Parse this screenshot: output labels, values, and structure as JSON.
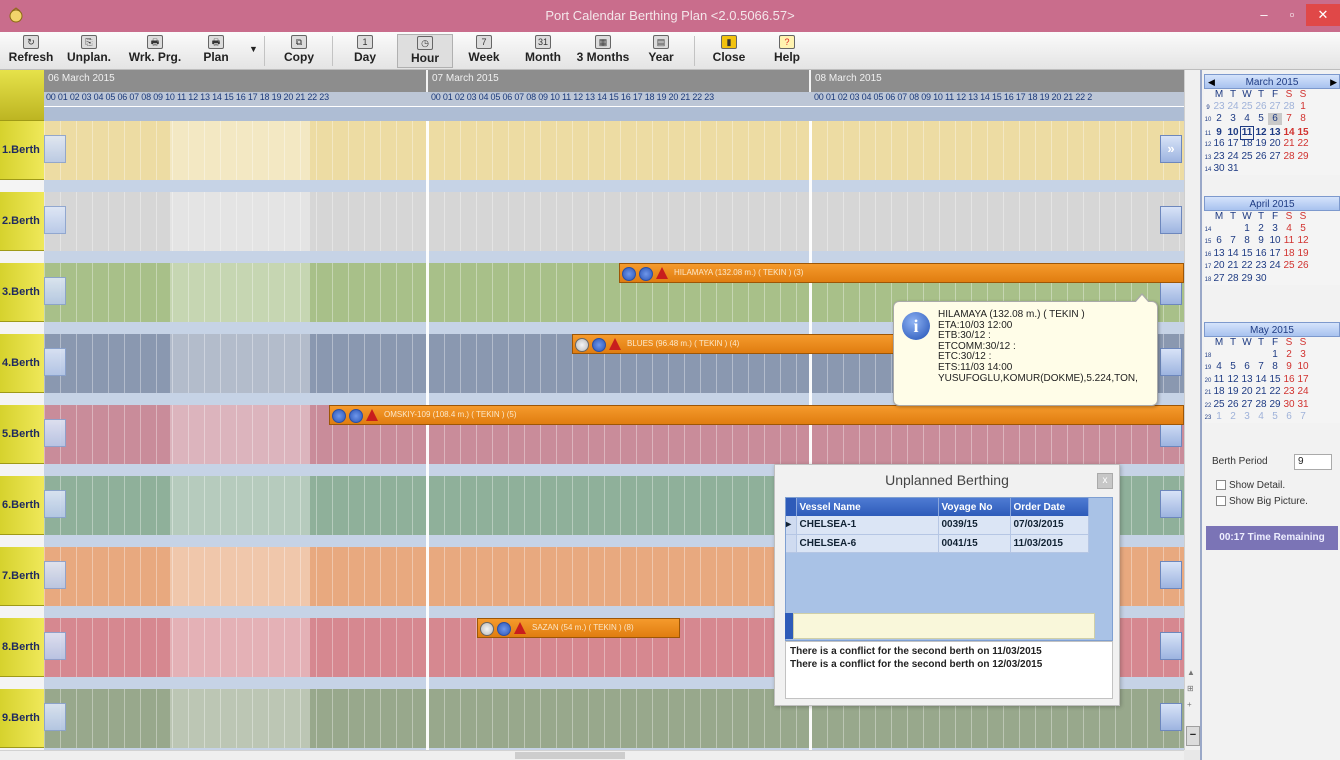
{
  "window": {
    "title": "Port Calendar Berthing Plan <2.0.5066.57>",
    "min": "–",
    "max": "▫",
    "close": "✕"
  },
  "toolbar": {
    "buttons": [
      {
        "label": "Refresh",
        "icon": "refresh-icon"
      },
      {
        "label": "Unplan.",
        "icon": "unplan-icon"
      },
      {
        "label": "Wrk. Prg.",
        "icon": "printer-icon"
      },
      {
        "label": "Plan",
        "icon": "printer-icon"
      },
      {
        "label": "Copy",
        "icon": "copy-icon"
      },
      {
        "label": "Day",
        "icon": "day-calendar-icon"
      },
      {
        "label": "Hour",
        "icon": "hour-icon"
      },
      {
        "label": "Week",
        "icon": "week-calendar-icon"
      },
      {
        "label": "Month",
        "icon": "month-calendar-icon"
      },
      {
        "label": "3 Months",
        "icon": "three-months-icon"
      },
      {
        "label": "Year",
        "icon": "year-icon"
      },
      {
        "label": "Close",
        "icon": "door-icon"
      },
      {
        "label": "Help",
        "icon": "help-icon"
      }
    ],
    "icon_glyphs": [
      "↻",
      "⎘",
      "🖶",
      "🖶",
      "⧉",
      "1",
      "◷",
      "7",
      "31",
      "▦",
      "▤",
      "▮",
      "?"
    ]
  },
  "timeline": {
    "days": [
      "06 March 2015",
      "07 March 2015",
      "08 March 2015"
    ],
    "hours": "00 01 02 03 04 05 06 07 08 09 10 11 12 13 14 15 16 17 18 19 20 21 22 23",
    "hours_partial": "00 01 02 03 04 05 06 07 08 09 10 11 12 13 14 15 16 17 18 19 20 21 22 2"
  },
  "berths": [
    "1.Berth",
    "2.Berth",
    "3.Berth",
    "4.Berth",
    "5.Berth",
    "6.Berth",
    "7.Berth",
    "8.Berth",
    "9.Berth"
  ],
  "berth_colors": [
    "#eddca3",
    "#d6d6d6",
    "#a8c089",
    "#8a98b0",
    "#c98c9a",
    "#8fb09a",
    "#e8a97f",
    "#d68890",
    "#98a88c"
  ],
  "nav_next": "»",
  "vessels": [
    {
      "text": "HILAMAYA (132.08 m.) ( TEKIN ) (3)"
    },
    {
      "text": "BLUES (96.48 m.) ( TEKIN ) (4)"
    },
    {
      "text": "OMSKIY-109 (108.4 m.) ( TEKIN ) (5)"
    },
    {
      "text": "SAZAN (54 m.) ( TEKIN ) (8)"
    }
  ],
  "tooltip": {
    "lines": [
      "HILAMAYA (132.08 m.) ( TEKIN )",
      "ETA:10/03 12:00",
      "ETB:30/12   :",
      "ETCOMM:30/12   :",
      "ETC:30/12   :",
      "ETS:11/03 14:00",
      "YUSUFOGLU,KOMUR(DOKME),5.224,TON,"
    ],
    "icon": "i"
  },
  "unplanned": {
    "title": "Unplanned Berthing",
    "close": "x",
    "columns": [
      "Vessel Name",
      "Voyage No",
      "Order Date"
    ],
    "rows": [
      [
        "CHELSEA-1",
        "0039/15",
        "07/03/2015"
      ],
      [
        "CHELSEA-6",
        "0041/15",
        "11/03/2015"
      ]
    ],
    "messages": [
      "There is a conflict for the second berth on 11/03/2015",
      "There is a conflict for the second berth on 12/03/2015"
    ]
  },
  "calendar": {
    "dows": [
      "M",
      "T",
      "W",
      "T",
      "F",
      "S",
      "S"
    ],
    "months": [
      {
        "title": "March 2015",
        "weeks": [
          [
            "9",
            "23",
            "24",
            "25",
            "26",
            "27",
            "28",
            "1"
          ],
          [
            "10",
            "2",
            "3",
            "4",
            "5",
            "6",
            "7",
            "8"
          ],
          [
            "11",
            "9",
            "10",
            "11",
            "12",
            "13",
            "14",
            "15"
          ],
          [
            "12",
            "16",
            "17",
            "18",
            "19",
            "20",
            "21",
            "22"
          ],
          [
            "13",
            "23",
            "24",
            "25",
            "26",
            "27",
            "28",
            "29"
          ],
          [
            "14",
            "30",
            "31",
            "",
            "",
            "",
            "",
            ""
          ]
        ]
      },
      {
        "title": "April 2015",
        "weeks": [
          [
            "14",
            "",
            "",
            "1",
            "2",
            "3",
            "4",
            "5"
          ],
          [
            "15",
            "6",
            "7",
            "8",
            "9",
            "10",
            "11",
            "12"
          ],
          [
            "16",
            "13",
            "14",
            "15",
            "16",
            "17",
            "18",
            "19"
          ],
          [
            "17",
            "20",
            "21",
            "22",
            "23",
            "24",
            "25",
            "26"
          ],
          [
            "18",
            "27",
            "28",
            "29",
            "30",
            "",
            "",
            ""
          ]
        ]
      },
      {
        "title": "May 2015",
        "weeks": [
          [
            "18",
            "",
            "",
            "",
            "",
            "1",
            "2",
            "3"
          ],
          [
            "19",
            "4",
            "5",
            "6",
            "7",
            "8",
            "9",
            "10"
          ],
          [
            "20",
            "11",
            "12",
            "13",
            "14",
            "15",
            "16",
            "17"
          ],
          [
            "21",
            "18",
            "19",
            "20",
            "21",
            "22",
            "23",
            "24"
          ],
          [
            "22",
            "25",
            "26",
            "27",
            "28",
            "29",
            "30",
            "31"
          ],
          [
            "23",
            "1",
            "2",
            "3",
            "4",
            "5",
            "6",
            "7"
          ]
        ]
      }
    ]
  },
  "side": {
    "berth_period_label": "Berth Period",
    "berth_period_value": "9",
    "show_detail": "Show Detail.",
    "show_big_picture": "Show Big Picture.",
    "time_remaining": "00:17 Time Remaining"
  }
}
